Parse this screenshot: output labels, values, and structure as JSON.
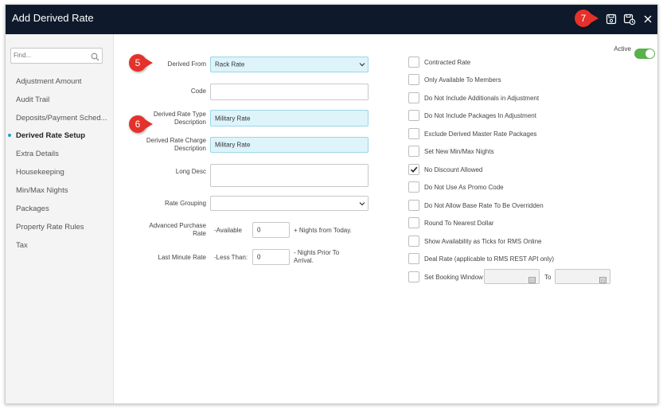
{
  "window": {
    "title": "Add Derived Rate"
  },
  "sidebar": {
    "find_placeholder": "Find...",
    "items": [
      {
        "label": "Adjustment Amount"
      },
      {
        "label": "Audit Trail"
      },
      {
        "label": "Deposits/Payment Sched..."
      },
      {
        "label": "Derived Rate Setup",
        "active": true
      },
      {
        "label": "Extra Details"
      },
      {
        "label": "Housekeeping"
      },
      {
        "label": "Min/Max Nights"
      },
      {
        "label": "Packages"
      },
      {
        "label": "Property Rate Rules"
      },
      {
        "label": "Tax"
      }
    ]
  },
  "form": {
    "derived_from": {
      "label": "Derived From",
      "value": "Rack Rate"
    },
    "code": {
      "label": "Code",
      "value": ""
    },
    "type_description": {
      "label_line1": "Derived Rate Type",
      "label_line2": "Description",
      "value": "Military Rate"
    },
    "charge_description": {
      "label_line1": "Derived Rate Charge",
      "label_line2": "Description",
      "value": "Military Rate"
    },
    "long_desc": {
      "label": "Long Desc",
      "value": ""
    },
    "rate_grouping": {
      "label": "Rate Grouping",
      "value": ""
    },
    "advanced_purchase": {
      "label_line1": "Advanced Purchase",
      "label_line2": "Rate",
      "prefix": "-Available",
      "value": "0",
      "suffix": "+ Nights from Today."
    },
    "last_minute": {
      "label": "Last Minute Rate",
      "prefix": "-Less Than:",
      "value": "0",
      "suffix_line1": "- Nights Prior To",
      "suffix_line2": "Arrival."
    }
  },
  "active": {
    "label": "Active",
    "on": true
  },
  "checkboxes": [
    {
      "label": "Contracted Rate",
      "checked": false
    },
    {
      "label": "Only Available To Members",
      "checked": false
    },
    {
      "label": "Do Not Include Additionals in Adjustment",
      "checked": false
    },
    {
      "label": "Do Not Include Packages In Adjustment",
      "checked": false
    },
    {
      "label": "Exclude Derived Master Rate Packages",
      "checked": false
    },
    {
      "label": "Set New Min/Max Nights",
      "checked": false
    },
    {
      "label": "No Discount Allowed",
      "checked": true
    },
    {
      "label": "Do Not Use As Promo Code",
      "checked": false
    },
    {
      "label": "Do Not Allow Base Rate To Be Overridden",
      "checked": false
    },
    {
      "label": "Round To Nearest Dollar",
      "checked": false
    },
    {
      "label": "Show Availability as Ticks for RMS Online",
      "checked": false
    },
    {
      "label": "Deal Rate (applicable to RMS REST API only)",
      "checked": false
    },
    {
      "label": "Set Booking Window",
      "checked": false
    }
  ],
  "booking_window": {
    "to_label": "To"
  },
  "callouts": {
    "c5": "5",
    "c6": "6",
    "c7": "7"
  },
  "colors": {
    "titlebar": "#0e1a2b",
    "highlight_field": "#ddf4fb",
    "toggle_on": "#5bb04b",
    "callout": "#e4312b",
    "active_dot": "#1aa3c8"
  },
  "icons": {
    "save": "save-icon",
    "save_copy": "save-copy-icon",
    "close": "close-icon",
    "search": "search-icon",
    "calendar": "calendar-icon",
    "chevron": "chevron-down-icon"
  }
}
